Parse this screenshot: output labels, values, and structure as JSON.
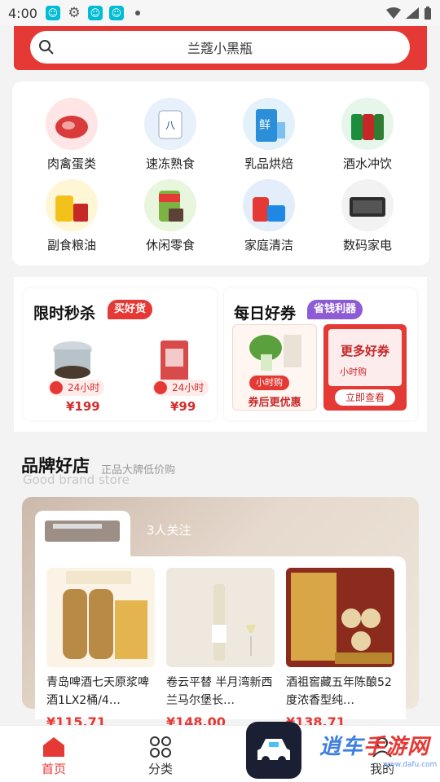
{
  "status_bar": {
    "time": "4:00"
  },
  "search": {
    "placeholder": "兰蔻小黑瓶"
  },
  "categories": [
    {
      "label": "肉禽蛋类",
      "icon": "meat-icon"
    },
    {
      "label": "速冻熟食",
      "icon": "frozen-food-icon"
    },
    {
      "label": "乳品烘焙",
      "icon": "milk-icon"
    },
    {
      "label": "酒水冲饮",
      "icon": "drinks-icon"
    },
    {
      "label": "副食粮油",
      "icon": "oil-icon"
    },
    {
      "label": "休闲零食",
      "icon": "snack-icon"
    },
    {
      "label": "家庭清洁",
      "icon": "cleaning-icon"
    },
    {
      "label": "数码家电",
      "icon": "speaker-icon"
    }
  ],
  "flash_sale": {
    "title": "限时秒杀",
    "tag": "买好货",
    "items": [
      {
        "hours": "24小时",
        "price": "¥199"
      },
      {
        "hours": "24小时",
        "price": "¥99"
      }
    ]
  },
  "coupons": {
    "title": "每日好券",
    "tag": "省钱利器",
    "left": {
      "badge": "小时购",
      "text": "券后更优惠"
    },
    "right": {
      "title": "更多好券",
      "badge": "小时购",
      "button": "立即查看"
    }
  },
  "brand": {
    "title": "品牌好店",
    "subtitle": "正品大牌低价购",
    "subtitle_en": "Good brand store",
    "followers": "3人关注"
  },
  "products": [
    {
      "name": "青岛啤酒七天原浆啤酒1LX2桶/4…",
      "price": "¥115.71"
    },
    {
      "name": "卷云平替 半月湾新西兰马尔堡长…",
      "price": "¥148.00"
    },
    {
      "name": "酒祖窖藏五年陈酿52度浓香型纯…",
      "price": "¥138.71"
    }
  ],
  "tabbar": [
    {
      "label": "首页"
    },
    {
      "label": "分类"
    },
    {
      "label": "我的"
    }
  ],
  "watermark": {
    "text1": "逍车",
    "text2": "手游网",
    "site": "www.dafu.com"
  },
  "colors": {
    "brand_red": "#e53935",
    "promo_purple": "#8e5bd6"
  }
}
